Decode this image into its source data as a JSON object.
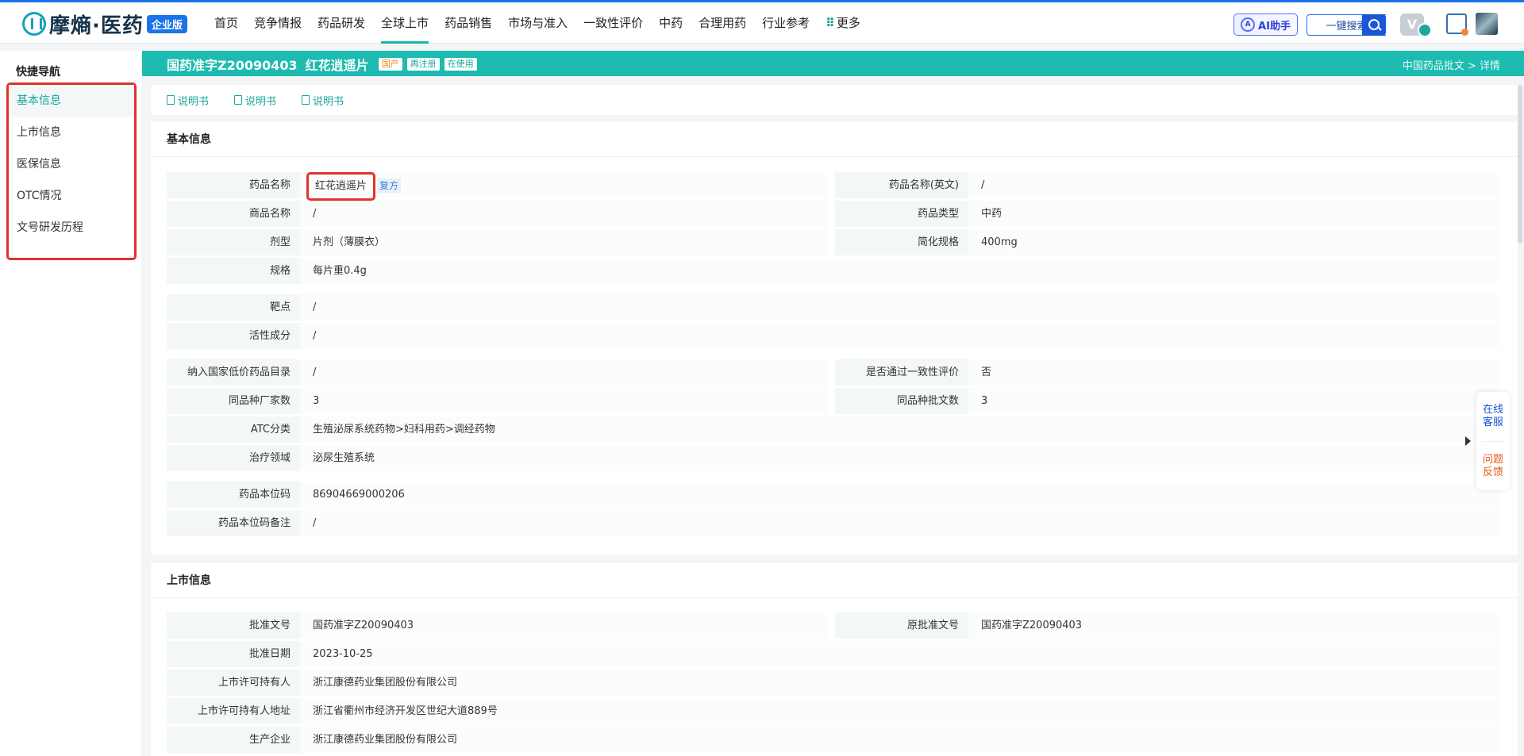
{
  "topnav": {
    "logo_text": "摩熵·医药",
    "logo_badge": "企业版",
    "items": [
      "首页",
      "竞争情报",
      "药品研发",
      "全球上市",
      "药品销售",
      "市场与准入",
      "一致性评价",
      "中药",
      "合理用药",
      "行业参考",
      "更多"
    ],
    "active_index": 3,
    "ai_label": "AI助手",
    "search_label": "一键搜索",
    "vip_label": "V"
  },
  "sidebar": {
    "title": "快捷导航",
    "items": [
      "基本信息",
      "上市信息",
      "医保信息",
      "OTC情况",
      "文号研发历程"
    ],
    "active_index": 0
  },
  "header": {
    "approval_no": "国药准字Z20090403",
    "drug_name": "红花逍遥片",
    "tags": [
      "国产",
      "再注册",
      "在使用"
    ],
    "breadcrumb": "中国药品批文 > 详情"
  },
  "doc_links": [
    "说明书",
    "说明书",
    "说明书"
  ],
  "basic": {
    "title": "基本信息",
    "drug_name_label": "药品名称",
    "drug_name_value": "红花逍遥片",
    "fufang_tag": "复方",
    "drug_name_en_label": "药品名称(英文)",
    "drug_name_en_value": "/",
    "trade_name_label": "商品名称",
    "trade_name_value": "/",
    "drug_type_label": "药品类型",
    "drug_type_value": "中药",
    "dosage_label": "剂型",
    "dosage_value": "片剂（薄膜衣）",
    "simple_spec_label": "简化规格",
    "simple_spec_value": "400mg",
    "spec_label": "规格",
    "spec_value": "每片重0.4g",
    "target_label": "靶点",
    "target_value": "/",
    "ingredient_label": "活性成分",
    "ingredient_value": "/",
    "lowprice_label": "纳入国家低价药品目录",
    "lowprice_value": "/",
    "consistency_label": "是否通过一致性评价",
    "consistency_value": "否",
    "mfr_count_label": "同品种厂家数",
    "mfr_count_value": "3",
    "approval_count_label": "同品种批文数",
    "approval_count_value": "3",
    "atc_label": "ATC分类",
    "atc_value": "生殖泌尿系统药物>妇科用药>调经药物",
    "area_label": "治疗领域",
    "area_value": "泌尿生殖系统",
    "code_label": "药品本位码",
    "code_value": "86904669000206",
    "code_note_label": "药品本位码备注",
    "code_note_value": "/"
  },
  "market": {
    "title": "上市信息",
    "approval_label": "批准文号",
    "approval_value": "国药准字Z20090403",
    "orig_approval_label": "原批准文号",
    "orig_approval_value": "国药准字Z20090403",
    "date_label": "批准日期",
    "date_value": "2023-10-25",
    "holder_label": "上市许可持有人",
    "holder_value": "浙江康德药业集团股份有限公司",
    "holder_addr_label": "上市许可持有人地址",
    "holder_addr_value": "浙江省衢州市经济开发区世纪大道889号",
    "producer_label": "生产企业",
    "producer_value": "浙江康德药业集团股份有限公司"
  },
  "float": {
    "service": "在线客服",
    "feedback": "问题反馈"
  }
}
